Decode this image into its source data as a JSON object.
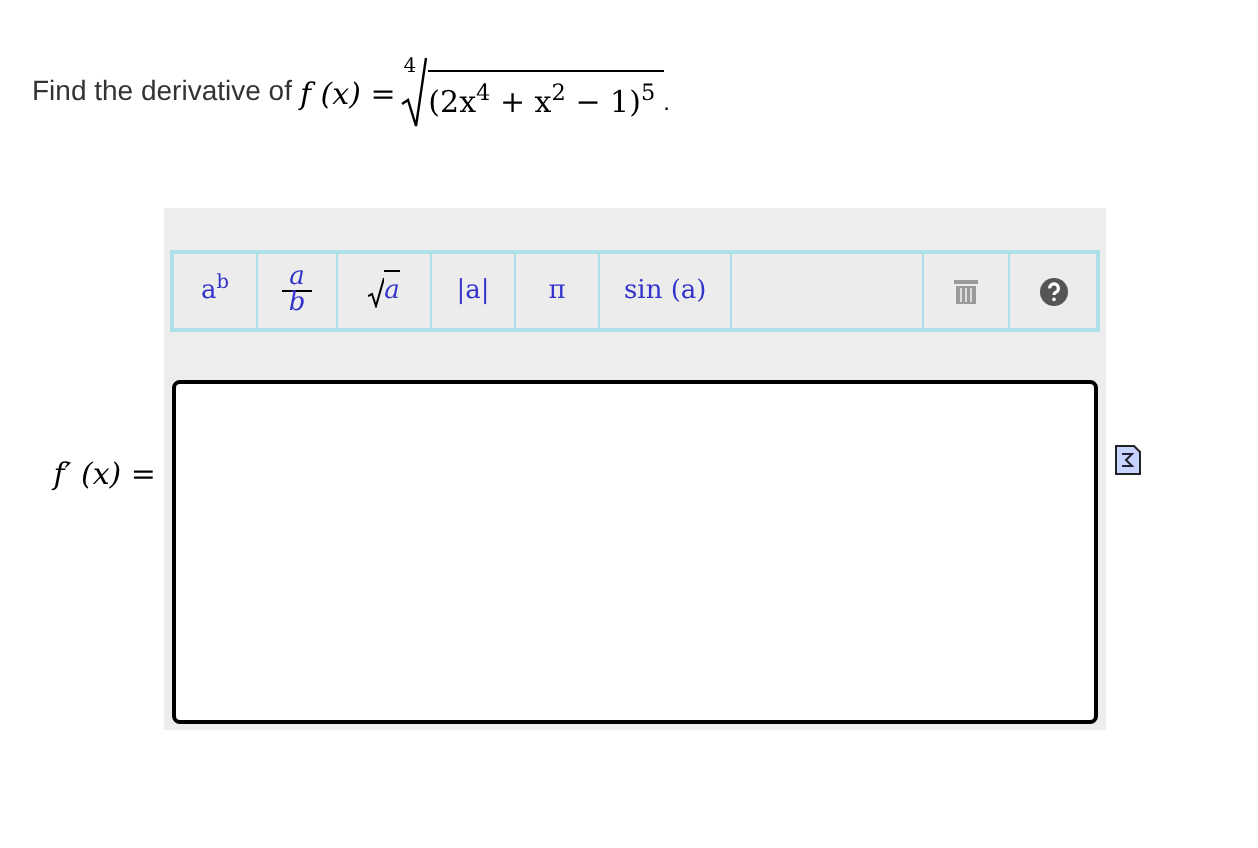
{
  "question": {
    "text": "Find the derivative of",
    "function": "f (x) =",
    "root_index": "4",
    "radicand": "(2x$^{4}$ + x$^{2}$ − 1)$^{5}$",
    "end": "."
  },
  "toolbar": [
    {
      "kind": "text",
      "label": "a$^{b}$"
    },
    {
      "kind": "fraction",
      "top": "a",
      "bottom": "b"
    },
    {
      "kind": "sqrt",
      "label": "a"
    },
    {
      "kind": "text",
      "label": "|a|"
    },
    {
      "kind": "text",
      "label": "π"
    },
    {
      "kind": "text",
      "label": "sin (a)"
    },
    {
      "kind": "spacer"
    },
    {
      "kind": "trash"
    },
    {
      "kind": "help"
    }
  ],
  "answer": {
    "label": "f′ (x) ="
  }
}
